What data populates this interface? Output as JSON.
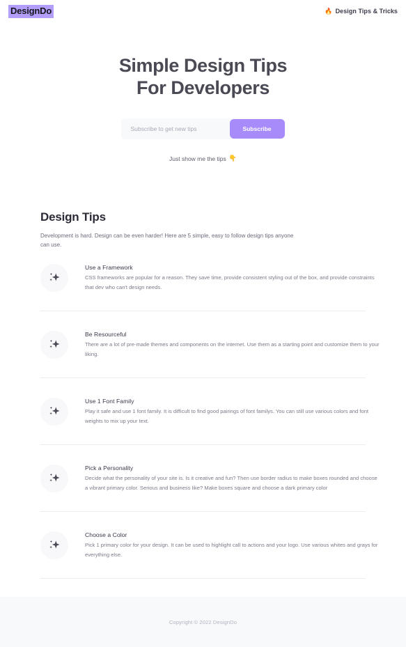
{
  "header": {
    "brand": "DesignDo",
    "nav_link": {
      "icon": "fire-emoji",
      "emoji": "🔥",
      "label": "Design Tips & Tricks"
    }
  },
  "hero": {
    "title_line1": "Simple Design Tips",
    "title_line2": "For Developers",
    "subscribe": {
      "placeholder": "Subscribe to get new tips",
      "value": "",
      "button_label": "Subscribe",
      "button_color": "#a78bfa"
    },
    "skip": {
      "label": "Just show me the tips",
      "icon": "pointing-down-hand-emoji",
      "emoji": "👇"
    }
  },
  "tips": {
    "heading": "Design Tips",
    "intro": "Development is hard. Design can be even harder! Here are 5 simple, easy to follow design tips anyone can use.",
    "items": [
      {
        "icon": "sparkles-icon",
        "title": "Use a Framework",
        "description": "CSS frameworks are popular for a reason. They save time, provide consistent styling out of the box, and provide constraints that dev who can't design needs."
      },
      {
        "icon": "sparkles-icon",
        "title": "Be Resourceful",
        "description": "There are a lot of pre-made themes and components on the internet. Use them as a starting point and customize them to your liking."
      },
      {
        "icon": "sparkles-icon",
        "title": "Use 1 Font Family",
        "description": "Play it safe and use 1 font family. It is difficult to find good pairings of font familys. You can still use various colors and font weights to mix up your text."
      },
      {
        "icon": "sparkles-icon",
        "title": "Pick a Personality",
        "description": "Decide what the personality of your site is. Is it creative and fun? Then use border radius to make boxes rounded and choose a vibrant primary color. Serious and business like? Make boxes square and choose a dark primary color"
      },
      {
        "icon": "sparkles-icon",
        "title": "Choose a Color",
        "description": "Pick 1 primary color for your design. It can be used to highlight call to actions and your logo. Use various whites and grays for everything else."
      }
    ]
  },
  "footer": {
    "copyright": "Copyright © 2022   DesignDo"
  }
}
